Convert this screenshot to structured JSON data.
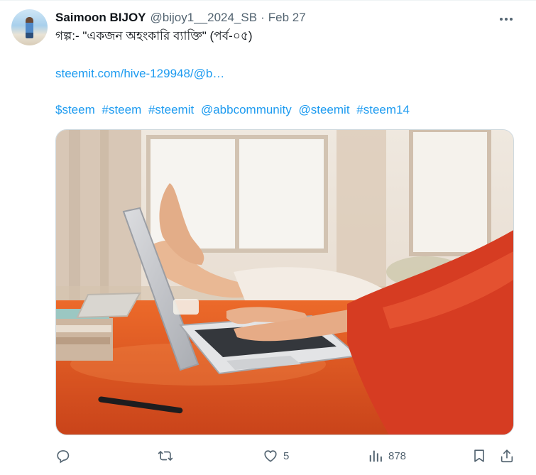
{
  "tweet": {
    "author_name": "Saimoon BIJOY",
    "handle": "@bijoy1__2024_SB",
    "separator": "·",
    "date": "Feb 27",
    "title_line": "গল্প:- \"একজন অহংকারি ব্যাক্তি\" (পর্ব-০৫)",
    "link_text": "steemit.com/hive-129948/@b…",
    "hashtags": [
      "$steem",
      "#steem",
      "#steemit",
      "@abbcommunity",
      "@steemit",
      "#steem14"
    ]
  },
  "actions": {
    "reply": {
      "icon": "reply-icon"
    },
    "retweet": {
      "icon": "retweet-icon"
    },
    "like": {
      "icon": "heart-icon",
      "count": "5"
    },
    "views": {
      "icon": "views-icon",
      "count": "878"
    },
    "bookmark": {
      "icon": "bookmark-icon"
    },
    "share": {
      "icon": "share-icon"
    }
  },
  "colors": {
    "link": "#1d9bf0",
    "muted": "#536471",
    "text": "#0f1419",
    "jacket": "#d63c22",
    "desk": "#e2541e"
  }
}
